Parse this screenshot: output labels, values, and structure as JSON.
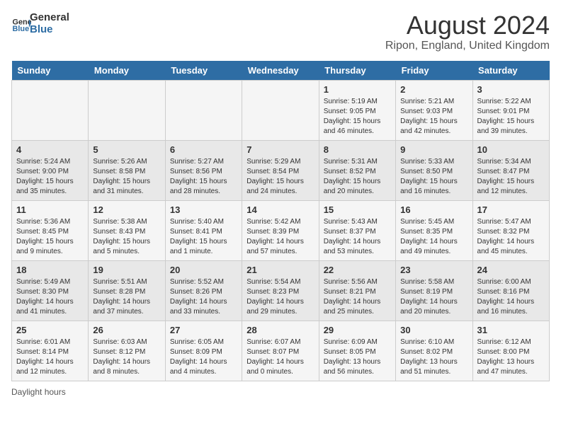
{
  "logo": {
    "line1": "General",
    "line2": "Blue",
    "arrow_color": "#2e6da4"
  },
  "title": "August 2024",
  "subtitle": "Ripon, England, United Kingdom",
  "days_of_week": [
    "Sunday",
    "Monday",
    "Tuesday",
    "Wednesday",
    "Thursday",
    "Friday",
    "Saturday"
  ],
  "weeks": [
    [
      {
        "day": "",
        "info": ""
      },
      {
        "day": "",
        "info": ""
      },
      {
        "day": "",
        "info": ""
      },
      {
        "day": "",
        "info": ""
      },
      {
        "day": "1",
        "info": "Sunrise: 5:19 AM\nSunset: 9:05 PM\nDaylight: 15 hours\nand 46 minutes."
      },
      {
        "day": "2",
        "info": "Sunrise: 5:21 AM\nSunset: 9:03 PM\nDaylight: 15 hours\nand 42 minutes."
      },
      {
        "day": "3",
        "info": "Sunrise: 5:22 AM\nSunset: 9:01 PM\nDaylight: 15 hours\nand 39 minutes."
      }
    ],
    [
      {
        "day": "4",
        "info": "Sunrise: 5:24 AM\nSunset: 9:00 PM\nDaylight: 15 hours\nand 35 minutes."
      },
      {
        "day": "5",
        "info": "Sunrise: 5:26 AM\nSunset: 8:58 PM\nDaylight: 15 hours\nand 31 minutes."
      },
      {
        "day": "6",
        "info": "Sunrise: 5:27 AM\nSunset: 8:56 PM\nDaylight: 15 hours\nand 28 minutes."
      },
      {
        "day": "7",
        "info": "Sunrise: 5:29 AM\nSunset: 8:54 PM\nDaylight: 15 hours\nand 24 minutes."
      },
      {
        "day": "8",
        "info": "Sunrise: 5:31 AM\nSunset: 8:52 PM\nDaylight: 15 hours\nand 20 minutes."
      },
      {
        "day": "9",
        "info": "Sunrise: 5:33 AM\nSunset: 8:50 PM\nDaylight: 15 hours\nand 16 minutes."
      },
      {
        "day": "10",
        "info": "Sunrise: 5:34 AM\nSunset: 8:47 PM\nDaylight: 15 hours\nand 12 minutes."
      }
    ],
    [
      {
        "day": "11",
        "info": "Sunrise: 5:36 AM\nSunset: 8:45 PM\nDaylight: 15 hours\nand 9 minutes."
      },
      {
        "day": "12",
        "info": "Sunrise: 5:38 AM\nSunset: 8:43 PM\nDaylight: 15 hours\nand 5 minutes."
      },
      {
        "day": "13",
        "info": "Sunrise: 5:40 AM\nSunset: 8:41 PM\nDaylight: 15 hours\nand 1 minute."
      },
      {
        "day": "14",
        "info": "Sunrise: 5:42 AM\nSunset: 8:39 PM\nDaylight: 14 hours\nand 57 minutes."
      },
      {
        "day": "15",
        "info": "Sunrise: 5:43 AM\nSunset: 8:37 PM\nDaylight: 14 hours\nand 53 minutes."
      },
      {
        "day": "16",
        "info": "Sunrise: 5:45 AM\nSunset: 8:35 PM\nDaylight: 14 hours\nand 49 minutes."
      },
      {
        "day": "17",
        "info": "Sunrise: 5:47 AM\nSunset: 8:32 PM\nDaylight: 14 hours\nand 45 minutes."
      }
    ],
    [
      {
        "day": "18",
        "info": "Sunrise: 5:49 AM\nSunset: 8:30 PM\nDaylight: 14 hours\nand 41 minutes."
      },
      {
        "day": "19",
        "info": "Sunrise: 5:51 AM\nSunset: 8:28 PM\nDaylight: 14 hours\nand 37 minutes."
      },
      {
        "day": "20",
        "info": "Sunrise: 5:52 AM\nSunset: 8:26 PM\nDaylight: 14 hours\nand 33 minutes."
      },
      {
        "day": "21",
        "info": "Sunrise: 5:54 AM\nSunset: 8:23 PM\nDaylight: 14 hours\nand 29 minutes."
      },
      {
        "day": "22",
        "info": "Sunrise: 5:56 AM\nSunset: 8:21 PM\nDaylight: 14 hours\nand 25 minutes."
      },
      {
        "day": "23",
        "info": "Sunrise: 5:58 AM\nSunset: 8:19 PM\nDaylight: 14 hours\nand 20 minutes."
      },
      {
        "day": "24",
        "info": "Sunrise: 6:00 AM\nSunset: 8:16 PM\nDaylight: 14 hours\nand 16 minutes."
      }
    ],
    [
      {
        "day": "25",
        "info": "Sunrise: 6:01 AM\nSunset: 8:14 PM\nDaylight: 14 hours\nand 12 minutes."
      },
      {
        "day": "26",
        "info": "Sunrise: 6:03 AM\nSunset: 8:12 PM\nDaylight: 14 hours\nand 8 minutes."
      },
      {
        "day": "27",
        "info": "Sunrise: 6:05 AM\nSunset: 8:09 PM\nDaylight: 14 hours\nand 4 minutes."
      },
      {
        "day": "28",
        "info": "Sunrise: 6:07 AM\nSunset: 8:07 PM\nDaylight: 14 hours\nand 0 minutes."
      },
      {
        "day": "29",
        "info": "Sunrise: 6:09 AM\nSunset: 8:05 PM\nDaylight: 13 hours\nand 56 minutes."
      },
      {
        "day": "30",
        "info": "Sunrise: 6:10 AM\nSunset: 8:02 PM\nDaylight: 13 hours\nand 51 minutes."
      },
      {
        "day": "31",
        "info": "Sunrise: 6:12 AM\nSunset: 8:00 PM\nDaylight: 13 hours\nand 47 minutes."
      }
    ]
  ],
  "footer": {
    "daylight_label": "Daylight hours"
  }
}
